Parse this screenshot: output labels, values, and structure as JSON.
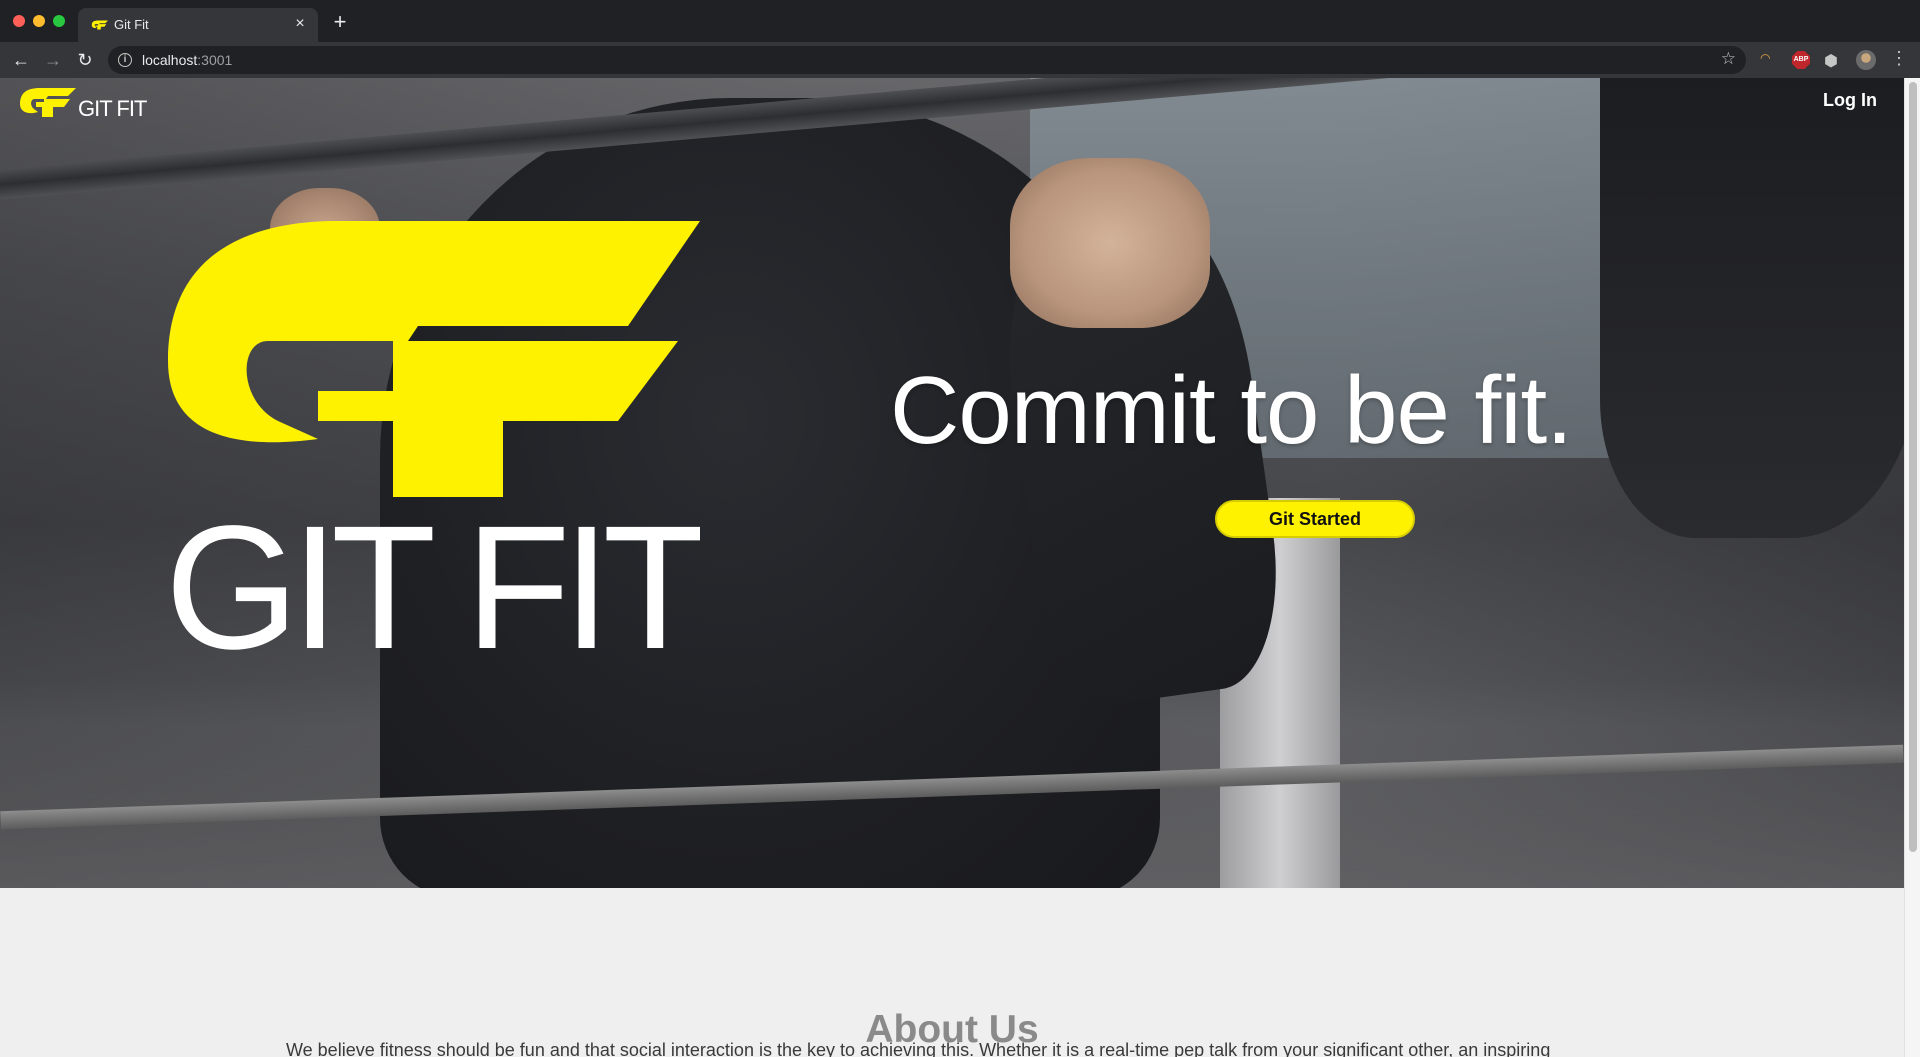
{
  "browser": {
    "tab_title": "Git Fit",
    "tab_close": "×",
    "new_tab": "+",
    "url_host": "localhost",
    "url_port": ":3001",
    "nav_back": "←",
    "nav_forward": "→",
    "nav_reload": "↻",
    "star": "☆",
    "extensions_icon": "⬢",
    "abp_label": "ABP",
    "menu": "⋮"
  },
  "site": {
    "nav_logo_text": "GIT FIT",
    "login_label": "Log In",
    "brand_word": "GIT FIT",
    "headline": "Commit to be fit.",
    "cta_label": "Git Started",
    "brand_color": "#fef200"
  },
  "about": {
    "title": "About Us",
    "text": "We believe fitness should be fun and that social interaction is the key to achieving this. Whether it is a real-time pep talk from your significant other, an inspiring"
  }
}
